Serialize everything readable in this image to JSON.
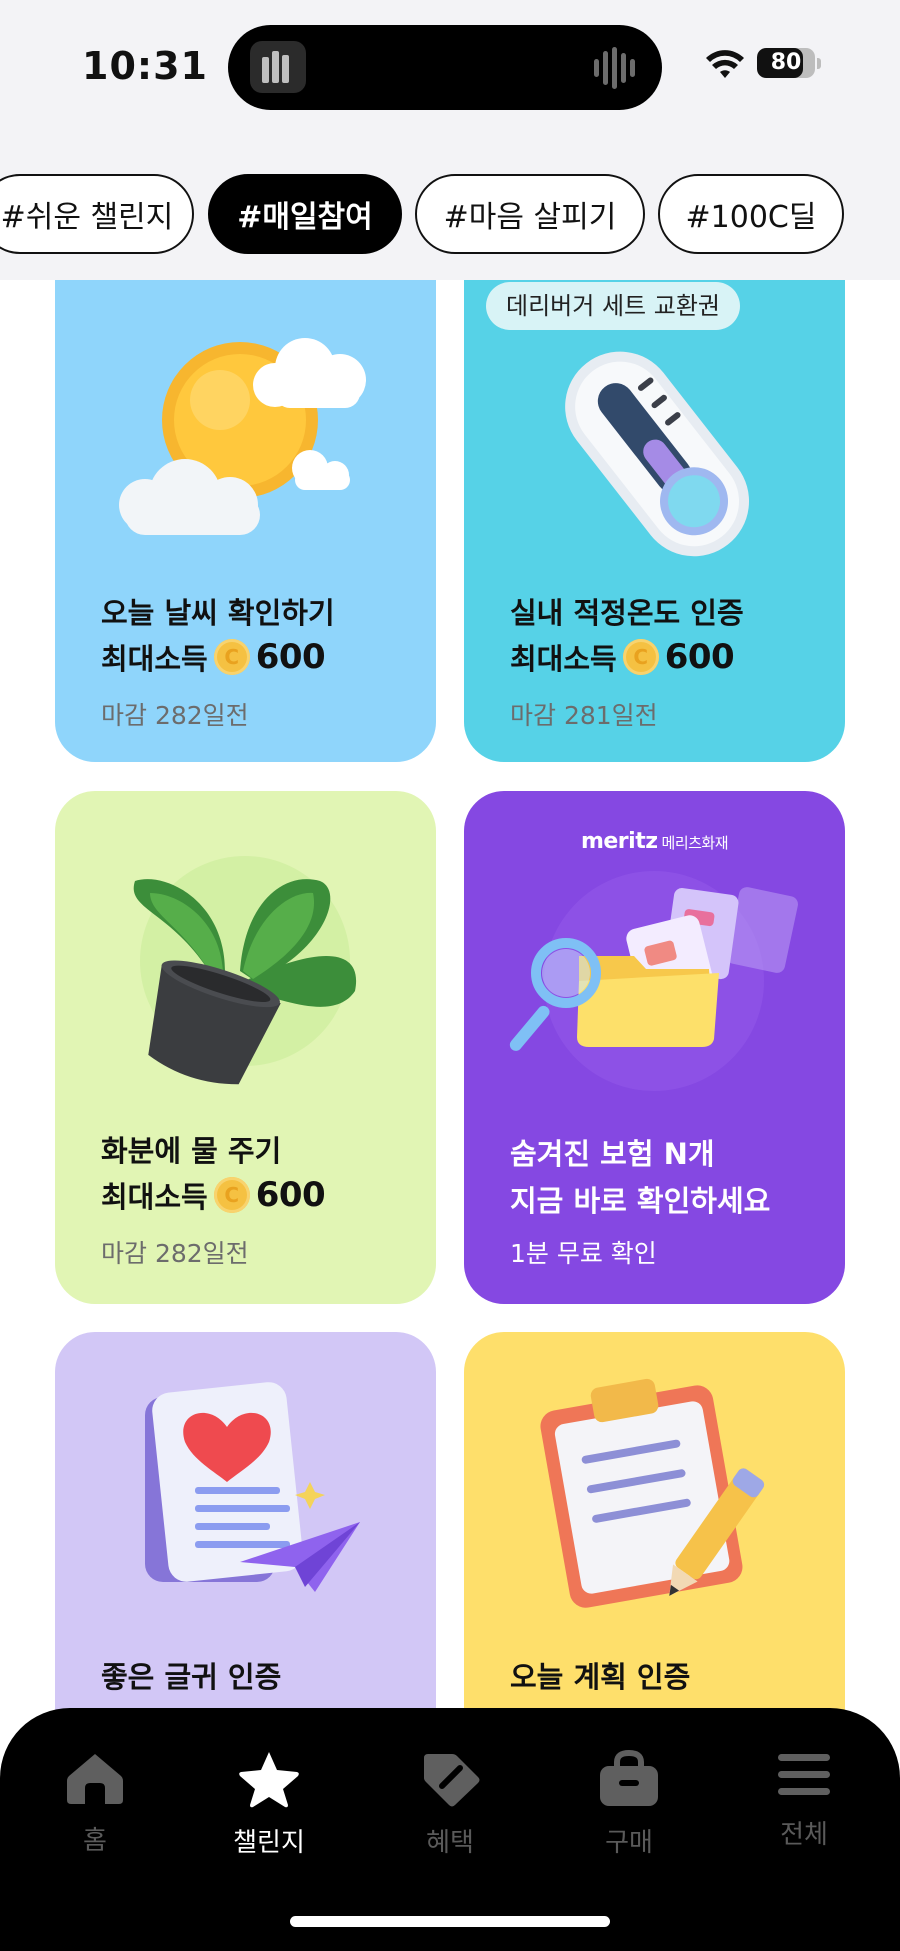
{
  "status_bar": {
    "time": "10:31",
    "battery": "80",
    "battery_level": 0.8,
    "wifi_icon": "wifi-icon"
  },
  "tags": [
    {
      "label": "#쉬운 챌린지",
      "active": false
    },
    {
      "label": "#매일참여",
      "active": true
    },
    {
      "label": "#마음 살피기",
      "active": false
    },
    {
      "label": "#100C딜",
      "active": false
    }
  ],
  "cards": [
    {
      "title": "오늘 날씨 확인하기",
      "reward_label": "최대소득",
      "reward_coin": "C",
      "reward_amount": "600",
      "deadline": "마감 282일전",
      "bg_color": "#8fd5fb",
      "icon": "sun-cloud-icon"
    },
    {
      "badge": "데리버거 세트 교환권",
      "title": "실내 적정온도 인증",
      "reward_label": "최대소득",
      "reward_coin": "C",
      "reward_amount": "600",
      "deadline": "마감 281일전",
      "bg_color": "#56d2e7",
      "icon": "thermometer-icon"
    },
    {
      "title": "화분에 물 주기",
      "reward_label": "최대소득",
      "reward_coin": "C",
      "reward_amount": "600",
      "deadline": "마감 282일전",
      "bg_color": "#e1f5b4",
      "icon": "potted-plant-icon"
    },
    {
      "ad_brand": "meritz",
      "ad_brand_sub": "메리츠화재",
      "title_line1": "숨겨진 보험 N개",
      "title_line2": "지금 바로 확인하세요",
      "sub": "1분 무료 확인",
      "bg_color": "#8548e2",
      "icon": "folder-search-icon"
    },
    {
      "title": "좋은 글귀 인증",
      "bg_color": "#d2c7f6",
      "icon": "letter-heart-icon"
    },
    {
      "title": "오늘 계획 인증",
      "bg_color": "#fedf6b",
      "icon": "clipboard-pencil-icon"
    }
  ],
  "nav": [
    {
      "label": "홈",
      "icon": "home-icon",
      "active": false
    },
    {
      "label": "챌린지",
      "icon": "star-icon",
      "active": true
    },
    {
      "label": "혜택",
      "icon": "tag-icon",
      "active": false
    },
    {
      "label": "구매",
      "icon": "bag-icon",
      "active": false
    },
    {
      "label": "전체",
      "icon": "menu-icon",
      "active": false
    }
  ]
}
